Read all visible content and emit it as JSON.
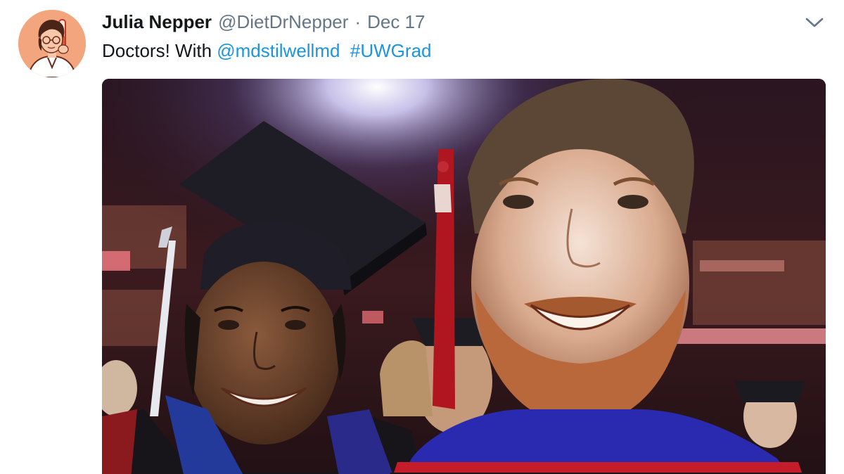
{
  "tweet": {
    "author": {
      "name": "Julia Nepper",
      "handle": "@DietDrNepper"
    },
    "separator": "·",
    "date": "Dec 17",
    "text": {
      "prefix": "Doctors! With ",
      "mention": "@mdstilwellmd",
      "hashtag": "#UWGrad"
    },
    "media": {
      "description": "Selfie photo of two graduates in caps and gowns at commencement"
    }
  },
  "icons": {
    "more_menu": "chevron-down-icon",
    "avatar": "illustrated-avatar"
  },
  "colors": {
    "name": "#14171a",
    "meta": "#657786",
    "link": "#1b95e0",
    "avatar_bg": "#f3a57e"
  }
}
